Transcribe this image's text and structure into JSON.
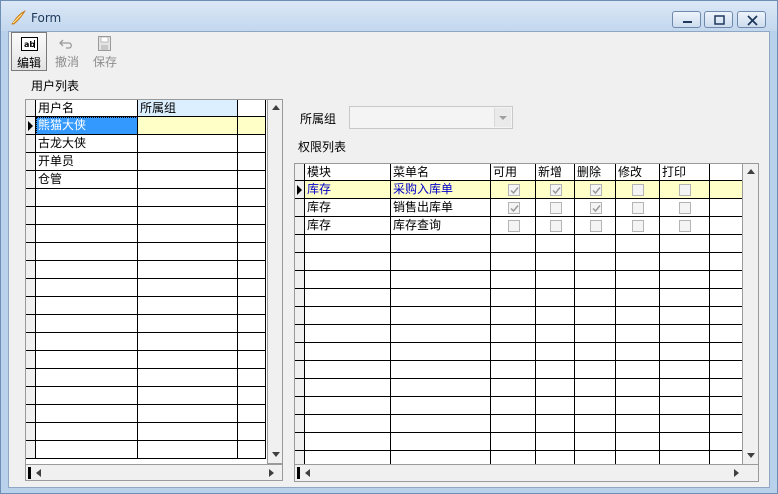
{
  "window": {
    "title": "Form"
  },
  "toolbar": {
    "edit_label": "编辑",
    "undo_label": "撤消",
    "save_label": "保存"
  },
  "user_list": {
    "label": "用户列表",
    "columns": [
      "用户名",
      "所属组"
    ],
    "rows": [
      {
        "name": "熊猫大侠",
        "group": ""
      },
      {
        "name": "古龙大侠",
        "group": ""
      },
      {
        "name": "开单员",
        "group": ""
      },
      {
        "name": "仓管",
        "group": ""
      }
    ]
  },
  "group_select": {
    "label": "所属组",
    "value": ""
  },
  "permission_list": {
    "label": "权限列表",
    "columns": [
      "模块",
      "菜单名",
      "可用",
      "新增",
      "删除",
      "修改",
      "打印"
    ],
    "rows": [
      {
        "module": "库存",
        "menu": "采购入库单",
        "enabled": true,
        "add": true,
        "delete": true,
        "modify": false,
        "print": false
      },
      {
        "module": "库存",
        "menu": "销售出库单",
        "enabled": true,
        "add": false,
        "delete": true,
        "modify": false,
        "print": false
      },
      {
        "module": "库存",
        "menu": "库存查询",
        "enabled": false,
        "add": false,
        "delete": false,
        "modify": false,
        "print": false
      }
    ]
  },
  "colors": {
    "selection": "#3399ff",
    "current_row": "#ffffc8",
    "window_frame": "#b9d1ea"
  }
}
